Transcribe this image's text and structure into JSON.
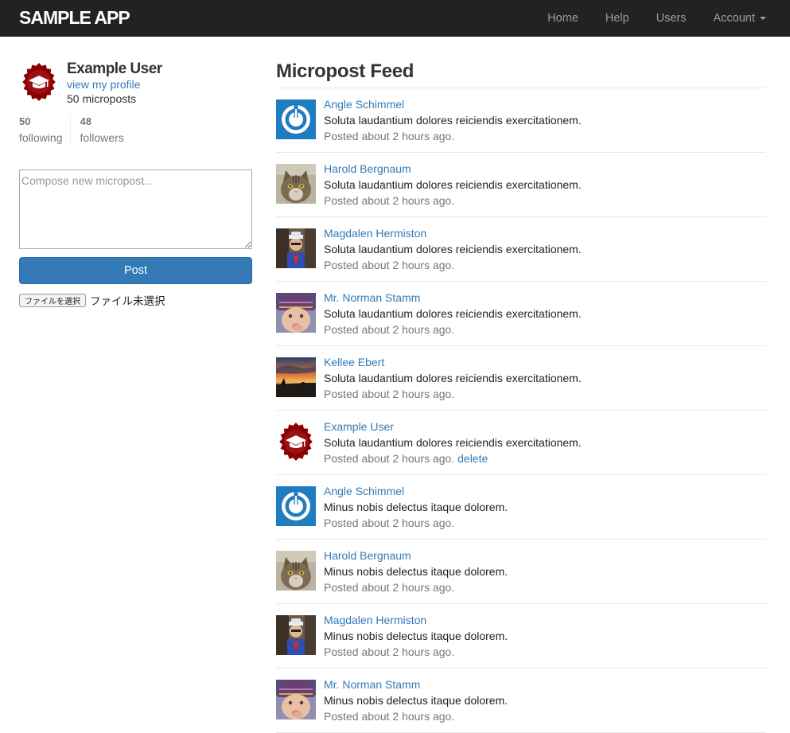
{
  "navbar": {
    "brand": "SAMPLE APP",
    "items": [
      {
        "label": "Home"
      },
      {
        "label": "Help"
      },
      {
        "label": "Users"
      },
      {
        "label": "Account"
      }
    ]
  },
  "sidebar": {
    "user_name": "Example User",
    "profile_link": "view my profile",
    "micropost_count": "50 microposts",
    "stats": {
      "following_count": "50",
      "following_label": "following",
      "followers_count": "48",
      "followers_label": "followers"
    },
    "compose_placeholder": "Compose new micropost...",
    "post_button": "Post",
    "file_button": "ファイルを選択",
    "file_status": "ファイル未選択"
  },
  "feed": {
    "title": "Micropost Feed",
    "posts": [
      {
        "user": "Angle Schimmel",
        "content": "Soluta laudantium dolores reiciendis exercitationem.",
        "time": "Posted about 2 hours ago.",
        "avatar": "power-icon"
      },
      {
        "user": "Harold Bergnaum",
        "content": "Soluta laudantium dolores reiciendis exercitationem.",
        "time": "Posted about 2 hours ago.",
        "avatar": "cat-photo"
      },
      {
        "user": "Magdalen Hermiston",
        "content": "Soluta laudantium dolores reiciendis exercitationem.",
        "time": "Posted about 2 hours ago.",
        "avatar": "person-photo"
      },
      {
        "user": "Mr. Norman Stamm",
        "content": "Soluta laudantium dolores reiciendis exercitationem.",
        "time": "Posted about 2 hours ago.",
        "avatar": "baby-photo"
      },
      {
        "user": "Kellee Ebert",
        "content": "Soluta laudantium dolores reiciendis exercitationem.",
        "time": "Posted about 2 hours ago.",
        "avatar": "sunset-photo"
      },
      {
        "user": "Example User",
        "content": "Soluta laudantium dolores reiciendis exercitationem.",
        "time": "Posted about 2 hours ago.",
        "delete": "delete",
        "avatar": "graduation-cap-icon"
      },
      {
        "user": "Angle Schimmel",
        "content": "Minus nobis delectus itaque dolorem.",
        "time": "Posted about 2 hours ago.",
        "avatar": "power-icon"
      },
      {
        "user": "Harold Bergnaum",
        "content": "Minus nobis delectus itaque dolorem.",
        "time": "Posted about 2 hours ago.",
        "avatar": "cat-photo"
      },
      {
        "user": "Magdalen Hermiston",
        "content": "Minus nobis delectus itaque dolorem.",
        "time": "Posted about 2 hours ago.",
        "avatar": "person-photo"
      },
      {
        "user": "Mr. Norman Stamm",
        "content": "Minus nobis delectus itaque dolorem.",
        "time": "Posted about 2 hours ago.",
        "avatar": "baby-photo"
      }
    ]
  },
  "colors": {
    "navbar_bg": "#222222",
    "link": "#337ab7",
    "muted": "#777777",
    "gravatar_red": "#8b0000",
    "power_blue": "#1f7cc0"
  }
}
